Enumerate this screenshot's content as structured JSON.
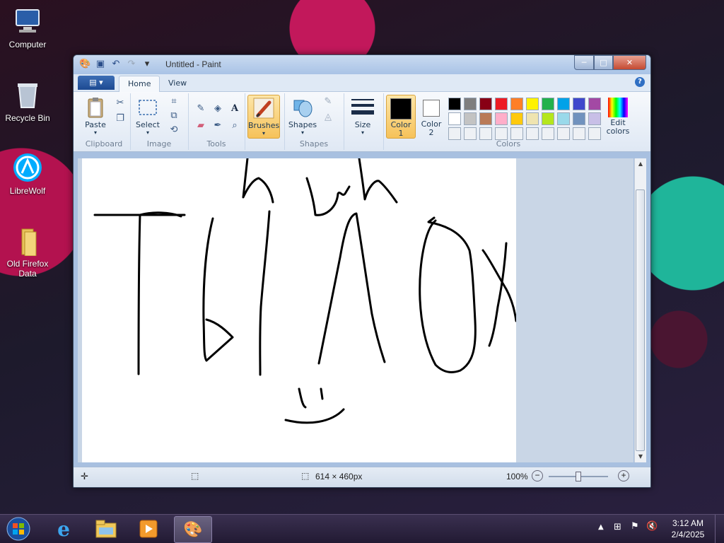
{
  "desktop": {
    "icons": [
      {
        "label": "Computer",
        "icon": "computer-icon"
      },
      {
        "label": "Recycle Bin",
        "icon": "recycle-bin-icon"
      },
      {
        "label": "LibreWolf",
        "icon": "librewolf-icon"
      },
      {
        "label": "Old Firefox Data",
        "icon": "folder-icon"
      }
    ]
  },
  "window": {
    "title": "Untitled - Paint",
    "controls": {
      "minimize": "─",
      "maximize": "□",
      "close": "✕"
    }
  },
  "tabs": {
    "file": "▤ ▾",
    "home": "Home",
    "view": "View",
    "help": "?"
  },
  "ribbon": {
    "clipboard": {
      "paste": "Paste",
      "label": "Clipboard"
    },
    "image": {
      "select": "Select",
      "label": "Image"
    },
    "tools": {
      "label": "Tools",
      "text_tool": "A"
    },
    "brushes": {
      "label": "Brushes"
    },
    "shapes": {
      "shapes": "Shapes",
      "label": "Shapes"
    },
    "size": {
      "label": "Size"
    },
    "colors": {
      "color1": "Color 1",
      "color1_line1": "Color",
      "color1_line2": "1",
      "color2": "Color 2",
      "color2_line1": "Color",
      "color2_line2": "2",
      "edit": "Edit colors",
      "edit_line1": "Edit",
      "edit_line2": "colors",
      "label": "Colors",
      "color1_value": "#000000",
      "color2_value": "#ffffff",
      "palette_row1": [
        "#000000",
        "#7f7f7f",
        "#880015",
        "#ed1c24",
        "#ff7f27",
        "#fff200",
        "#22b14c",
        "#00a2e8",
        "#3f48cc",
        "#a349a4"
      ],
      "palette_row2": [
        "#ffffff",
        "#c3c3c3",
        "#b97a57",
        "#ffaec9",
        "#ffc90e",
        "#efe4b0",
        "#b5e61d",
        "#99d9ea",
        "#7092be",
        "#c8bfe7"
      ]
    }
  },
  "status": {
    "canvas_size": "614 × 460px",
    "zoom": "100%",
    "zoom_level": 0.5
  },
  "taskbar": {
    "start": "start-orb-icon",
    "time": "3:12 AM",
    "date": "2/4/2025"
  }
}
